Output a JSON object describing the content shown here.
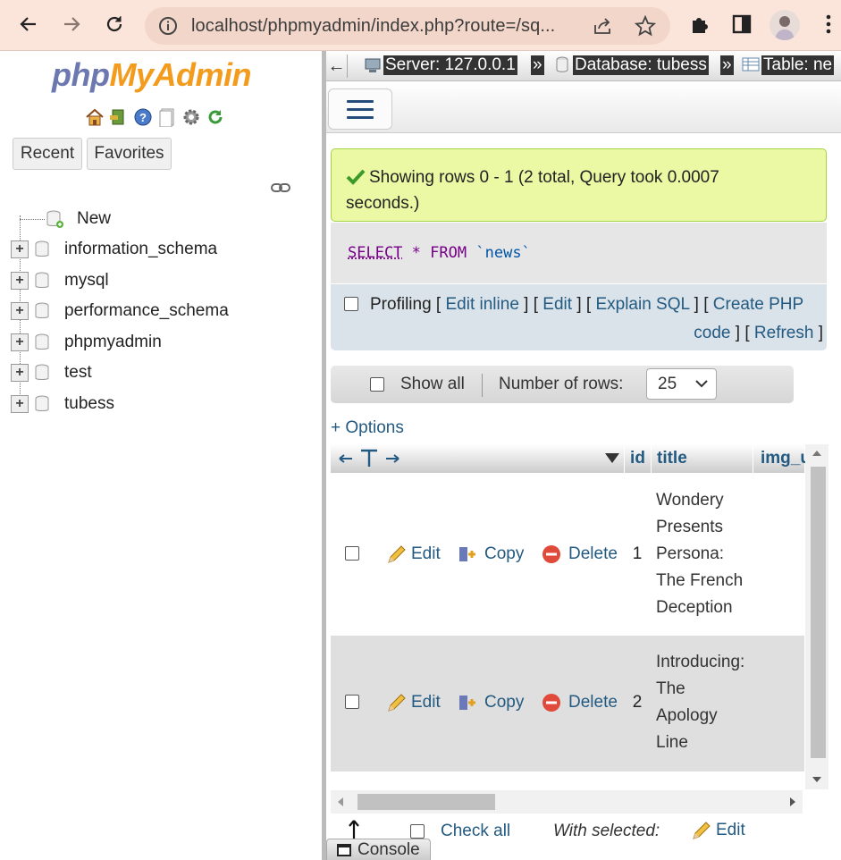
{
  "browser": {
    "url": "localhost/phpmyadmin/index.php?route=/sq...",
    "icons": [
      "back-arrow-icon",
      "forward-arrow-icon",
      "reload-icon",
      "info-icon",
      "share-icon",
      "star-icon",
      "extensions-icon",
      "sidepanel-icon",
      "profile-avatar",
      "menu-dots-icon"
    ]
  },
  "sidebar": {
    "logo_php": "php",
    "logo_my": "MyAdmin",
    "tabs": [
      "Recent",
      "Favorites"
    ],
    "tree": [
      {
        "label": "New"
      },
      {
        "label": "information_schema"
      },
      {
        "label": "mysql"
      },
      {
        "label": "performance_schema"
      },
      {
        "label": "phpmyadmin"
      },
      {
        "label": "test"
      },
      {
        "label": "tubess"
      }
    ]
  },
  "breadcrumbs": {
    "back": "←",
    "server": "Server: 127.0.0.1",
    "database": "Database: tubess",
    "table": "Table: ne",
    "sep": "»"
  },
  "result": {
    "message_line1": "Showing rows 0 - 1 (2 total, Query took 0.0007",
    "message_line2": "seconds.)",
    "sql_select": "SELECT",
    "sql_star": "*",
    "sql_from": "FROM",
    "sql_table": "`news`"
  },
  "query_options": {
    "profiling": "Profiling",
    "edit_inline": "Edit inline",
    "edit": "Edit",
    "explain": "Explain SQL",
    "create_php": "Create PHP",
    "code": "code",
    "refresh": "Refresh"
  },
  "navigation": {
    "show_all": "Show all",
    "rows_label": "Number of rows:",
    "rows_value": "25"
  },
  "options_link": "+ Options",
  "table": {
    "headers": [
      "id",
      "title",
      "img_u"
    ],
    "rows": [
      {
        "id": "1",
        "title_lines": [
          "Wondery",
          "Presents",
          "Persona:",
          "The French",
          "Deception"
        ]
      },
      {
        "id": "2",
        "title_lines": [
          "Introducing:",
          "The",
          "Apology",
          "Line"
        ]
      }
    ],
    "actions": {
      "edit": "Edit",
      "copy": "Copy",
      "delete": "Delete"
    }
  },
  "bulk": {
    "check_all": "Check all",
    "with_selected": "With selected:",
    "edit": "Edit"
  },
  "console": "Console"
}
